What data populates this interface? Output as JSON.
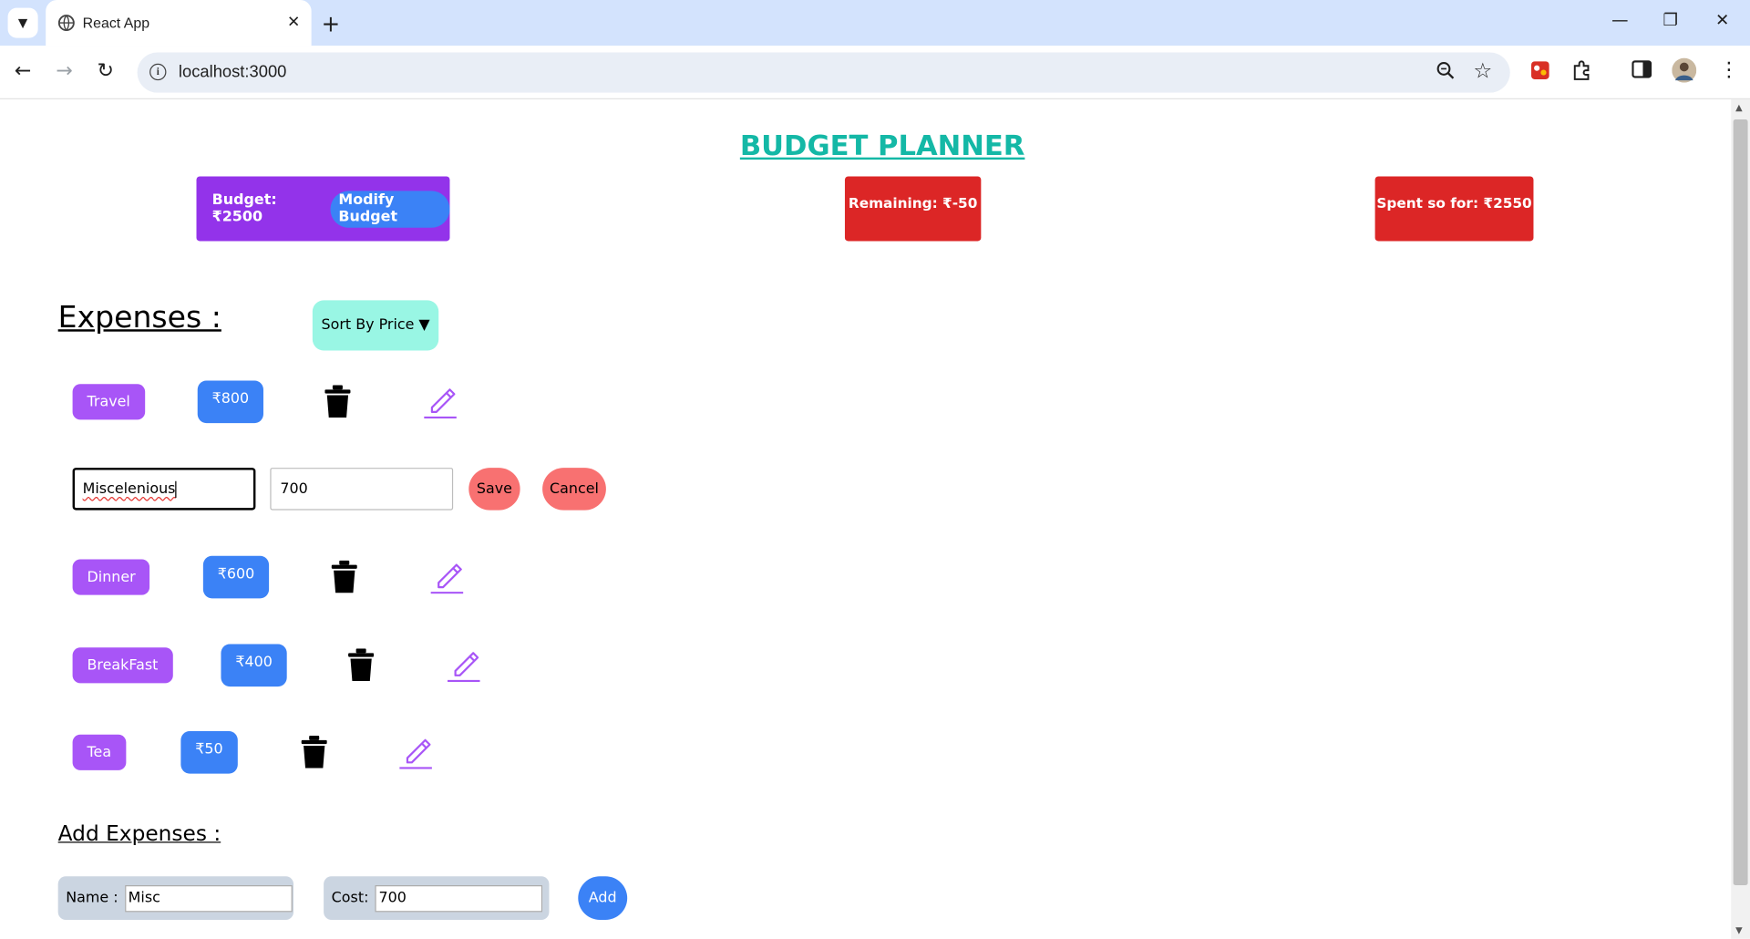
{
  "browser": {
    "tab_title": "React App",
    "url": "localhost:3000"
  },
  "app": {
    "title": "BUDGET PLANNER",
    "budget_label": "Budget: ₹2500",
    "modify_budget_label": "Modify Budget",
    "remaining_label": "Remaining: ₹-50",
    "spent_label": "Spent so for: ₹2550",
    "expenses_heading": "Expenses :",
    "sort_label": "Sort By Price",
    "expenses": [
      {
        "name": "Travel",
        "price": "₹800"
      },
      {
        "name": "Dinner",
        "price": "₹600"
      },
      {
        "name": "BreakFast",
        "price": "₹400"
      },
      {
        "name": "Tea",
        "price": "₹50"
      }
    ],
    "edit_row": {
      "name_value": "Miscelenious",
      "cost_value": "700",
      "save_label": "Save",
      "cancel_label": "Cancel"
    },
    "add_heading": "Add Expenses :",
    "add_form": {
      "name_label": "Name :",
      "name_value": "Misc",
      "cost_label": "Cost:",
      "cost_value": "700",
      "add_label": "Add"
    }
  },
  "colors": {
    "title": "#14b8a6",
    "budget_box": "#9333ea",
    "button_blue": "#3b82f6",
    "alert_red": "#dc2626",
    "name_pill": "#a855f7",
    "sort_button": "#99f6e4",
    "edit_buttons": "#f87171",
    "form_group": "#cbd5e1"
  }
}
